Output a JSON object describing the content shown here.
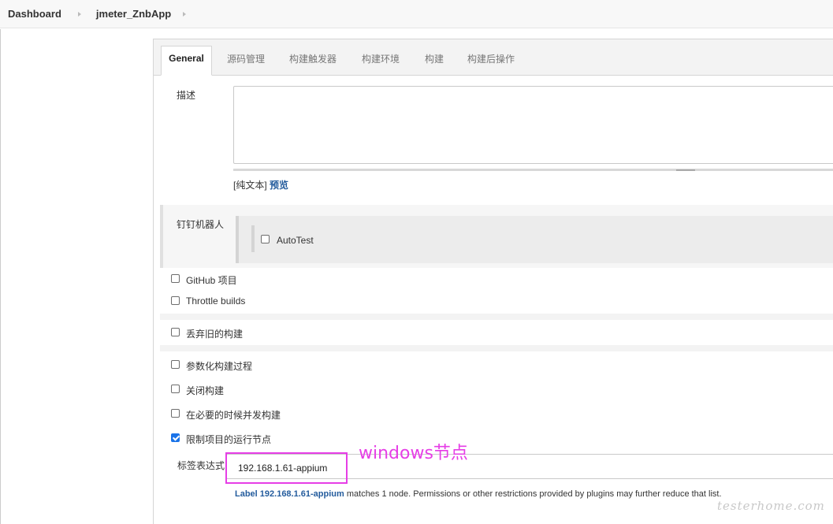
{
  "breadcrumb": {
    "items": [
      "Dashboard",
      "jmeter_ZnbApp"
    ]
  },
  "tabs": [
    "General",
    "源码管理",
    "构建触发器",
    "构建环境",
    "构建",
    "构建后操作"
  ],
  "description": {
    "label": "描述",
    "value": "",
    "preview_prefix": "[纯文本]",
    "preview_link": "预览"
  },
  "dingtalk": {
    "label": "钉钉机器人",
    "robot_name": "AutoTest"
  },
  "options": [
    {
      "label": "GitHub 项目",
      "checked": false
    },
    {
      "label": "Throttle builds",
      "checked": false
    },
    {
      "label": "丢弃旧的构建",
      "checked": false
    },
    {
      "label": "参数化构建过程",
      "checked": false
    },
    {
      "label": "关闭构建",
      "checked": false
    },
    {
      "label": "在必要的时候并发构建",
      "checked": false
    },
    {
      "label": "限制项目的运行节点",
      "checked": true
    }
  ],
  "label_expression": {
    "label": "标签表达式",
    "value": "192.168.1.61-appium"
  },
  "annotation": "windows节点",
  "match_message": {
    "link": "Label 192.168.1.61-appium",
    "text": " matches 1 node. Permissions or other restrictions provided by plugins may further reduce that list."
  },
  "watermark": "testerhome.com",
  "colors": {
    "accent": "#1a73e8",
    "link": "#245c9d",
    "annotation": "#e63ee6"
  }
}
